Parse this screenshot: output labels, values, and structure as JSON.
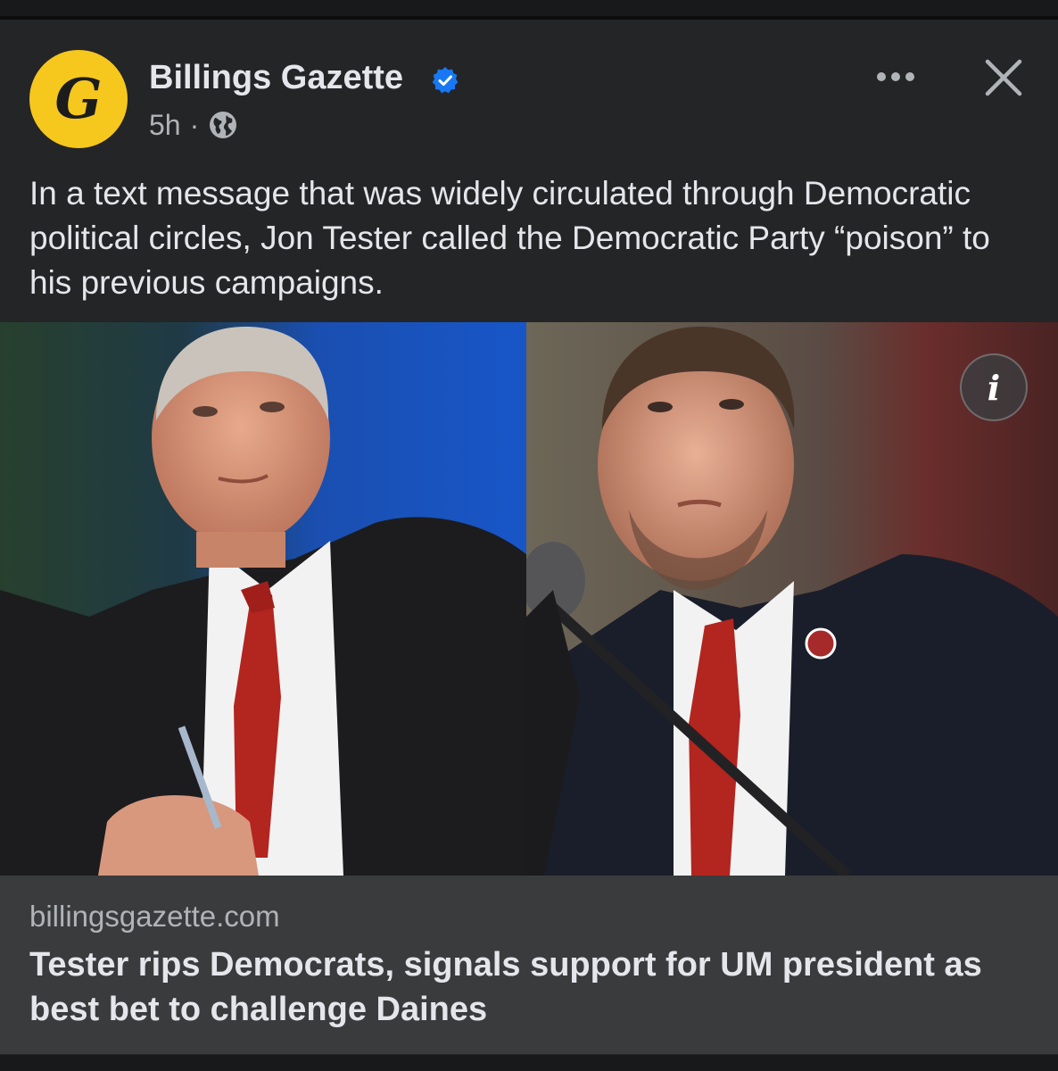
{
  "post": {
    "page_name": "Billings Gazette",
    "verified_icon": "verified-badge-icon",
    "avatar_letter": "G",
    "timestamp": "5h",
    "separator": "·",
    "audience_icon": "globe-icon",
    "more_icon": "more-horizontal-icon",
    "close_icon": "close-icon",
    "text": "In a text message that was widely circulated through Democratic political circles, Jon Tester called the Democratic Party “poison” to his previous campaigns."
  },
  "media": {
    "left_photo": "photo-jon-tester",
    "right_photo": "photo-um-president",
    "info_label": "i"
  },
  "link": {
    "domain": "billingsgazette.com",
    "title": "Tester rips Democrats, signals support for UM president as best bet to challenge Daines"
  },
  "colors": {
    "background": "#18191a",
    "card": "#242526",
    "link_preview": "#3a3b3c",
    "avatar": "#f6c71d",
    "verified": "#1877f2",
    "text_primary": "#e4e6eb",
    "text_secondary": "#b0b3b8"
  }
}
